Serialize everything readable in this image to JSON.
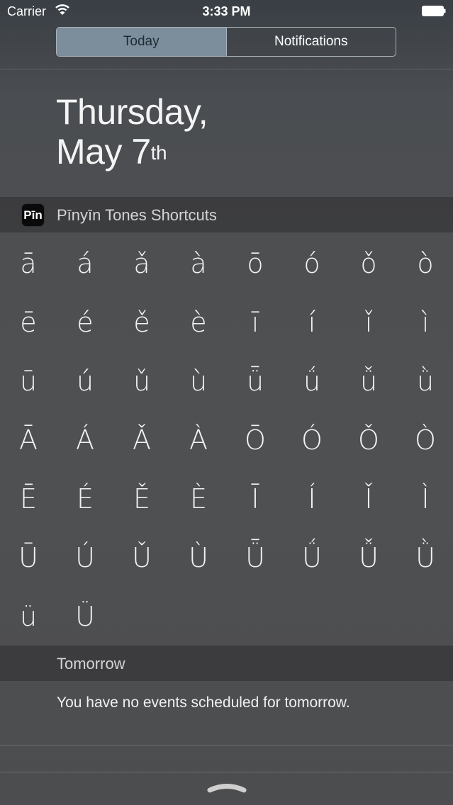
{
  "status_bar": {
    "carrier": "Carrier",
    "time": "3:33 PM",
    "wifi_icon": "wifi-icon",
    "battery_icon": "battery-icon"
  },
  "tabs": [
    {
      "label": "Today",
      "selected": true
    },
    {
      "label": "Notifications",
      "selected": false
    }
  ],
  "date": {
    "weekday": "Thursday,",
    "month_day": "May 7",
    "suffix": "th"
  },
  "widget": {
    "app_icon_text": "Pīn",
    "title": "Pīnyīn Tones Shortcuts",
    "keys": [
      "ā",
      "á",
      "ǎ",
      "à",
      "ō",
      "ó",
      "ǒ",
      "ò",
      "ē",
      "é",
      "ě",
      "è",
      "ī",
      "í",
      "ǐ",
      "ì",
      "ū",
      "ú",
      "ǔ",
      "ù",
      "ǖ",
      "ǘ",
      "ǚ",
      "ǜ",
      "Ā",
      "Á",
      "Ǎ",
      "À",
      "Ō",
      "Ó",
      "Ǒ",
      "Ò",
      "Ē",
      "É",
      "Ě",
      "È",
      "Ī",
      "Í",
      "Ǐ",
      "Ì",
      "Ū",
      "Ú",
      "Ǔ",
      "Ù",
      "Ǖ",
      "Ǘ",
      "Ǚ",
      "Ǜ",
      "ü",
      "Ü"
    ]
  },
  "tomorrow": {
    "title": "Tomorrow",
    "message": "You have no events scheduled for tomorrow."
  },
  "grabber_icon": "chevron-up-grabber-icon"
}
